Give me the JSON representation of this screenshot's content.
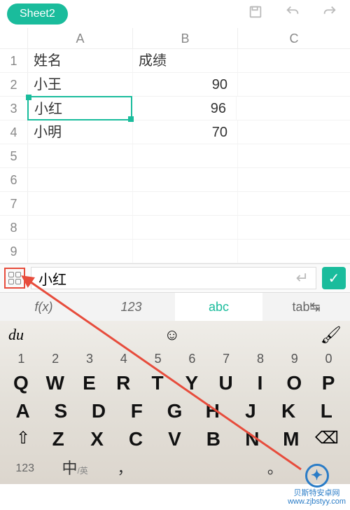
{
  "toolbar": {
    "sheet_name": "Sheet2"
  },
  "columns": [
    "A",
    "B",
    "C"
  ],
  "rows": [
    {
      "n": "1",
      "a": "姓名",
      "b": "成绩",
      "b_num": false
    },
    {
      "n": "2",
      "a": "小王",
      "b": "90",
      "b_num": true
    },
    {
      "n": "3",
      "a": "小红",
      "b": "96",
      "b_num": true,
      "selected": true
    },
    {
      "n": "4",
      "a": "小明",
      "b": "70",
      "b_num": true
    },
    {
      "n": "5",
      "a": "",
      "b": ""
    },
    {
      "n": "6",
      "a": "",
      "b": ""
    },
    {
      "n": "7",
      "a": "",
      "b": ""
    },
    {
      "n": "8",
      "a": "",
      "b": ""
    },
    {
      "n": "9",
      "a": "",
      "b": ""
    }
  ],
  "chart_data": {
    "type": "table",
    "columns": [
      "姓名",
      "成绩"
    ],
    "rows": [
      [
        "小王",
        90
      ],
      [
        "小红",
        96
      ],
      [
        "小明",
        70
      ]
    ]
  },
  "formula_bar": {
    "value": "小红"
  },
  "mode_bar": {
    "fx": "f(x)",
    "num": "123",
    "abc": "abc",
    "tab": "tab↹"
  },
  "keyboard": {
    "brand": "du",
    "numbers": [
      "1",
      "2",
      "3",
      "4",
      "5",
      "6",
      "7",
      "8",
      "9",
      "0"
    ],
    "row1": [
      "Q",
      "W",
      "E",
      "R",
      "T",
      "Y",
      "U",
      "I",
      "O",
      "P"
    ],
    "row2": [
      "A",
      "S",
      "D",
      "F",
      "G",
      "H",
      "J",
      "K",
      "L"
    ],
    "row3": [
      "Z",
      "X",
      "C",
      "V",
      "B",
      "N",
      "M"
    ],
    "bottom": {
      "num": "123",
      "lang": "中",
      "lang_sub": "/英",
      "comma": "，",
      "period": "。"
    }
  },
  "watermark": {
    "name": "贝斯特安卓网",
    "url": "www.zjbstyy.com"
  }
}
